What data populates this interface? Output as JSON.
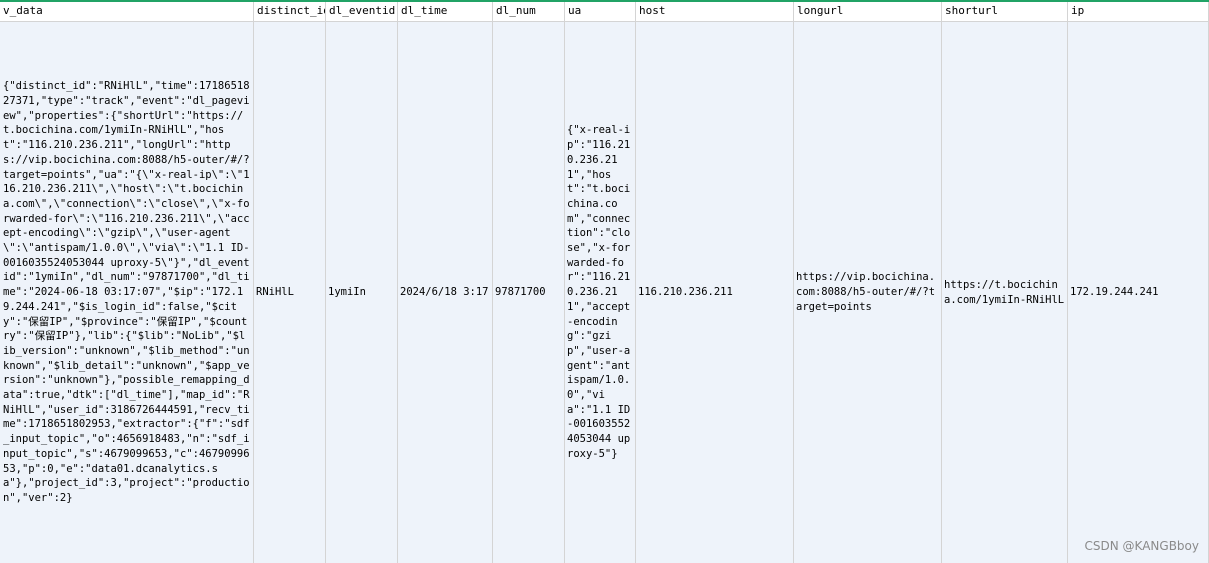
{
  "columns": [
    "v_data",
    "distinct_id",
    "dl_eventid",
    "dl_time",
    "dl_num",
    "ua",
    "host",
    "longurl",
    "shorturl",
    "ip"
  ],
  "row": {
    "v_data": "{\"distinct_id\":\"RNiHlL\",\"time\":1718651827371,\"type\":\"track\",\"event\":\"dl_pageview\",\"properties\":{\"shortUrl\":\"https://t.bocichina.com/1ymiIn-RNiHlL\",\"host\":\"116.210.236.211\",\"longUrl\":\"https://vip.bocichina.com:8088/h5-outer/#/?target=points\",\"ua\":\"{\\\"x-real-ip\\\":\\\"116.210.236.211\\\",\\\"host\\\":\\\"t.bocichina.com\\\",\\\"connection\\\":\\\"close\\\",\\\"x-forwarded-for\\\":\\\"116.210.236.211\\\",\\\"accept-encoding\\\":\\\"gzip\\\",\\\"user-agent\\\":\\\"antispam/1.0.0\\\",\\\"via\\\":\\\"1.1 ID-0016035524053044 uproxy-5\\\"}\",\"dl_eventid\":\"1ymiIn\",\"dl_num\":\"97871700\",\"dl_time\":\"2024-06-18 03:17:07\",\"$ip\":\"172.19.244.241\",\"$is_login_id\":false,\"$city\":\"保留IP\",\"$province\":\"保留IP\",\"$country\":\"保留IP\"},\"lib\":{\"$lib\":\"NoLib\",\"$lib_version\":\"unknown\",\"$lib_method\":\"unknown\",\"$lib_detail\":\"unknown\",\"$app_version\":\"unknown\"},\"possible_remapping_data\":true,\"dtk\":[\"dl_time\"],\"map_id\":\"RNiHlL\",\"user_id\":3186726444591,\"recv_time\":1718651802953,\"extractor\":{\"f\":\"sdf_input_topic\",\"o\":4656918483,\"n\":\"sdf_input_topic\",\"s\":4679099653,\"c\":4679099653,\"p\":0,\"e\":\"data01.dcanalytics.sa\"},\"project_id\":3,\"project\":\"production\",\"ver\":2}",
    "distinct_id": "RNiHlL",
    "dl_eventid": "1ymiIn",
    "dl_time": "2024/6/18 3:17",
    "dl_num": "97871700",
    "ua": "{\"x-real-ip\":\"116.210.236.211\",\"host\":\"t.bocichina.com\",\"connection\":\"close\",\"x-forwarded-for\":\"116.210.236.211\",\"accept-encoding\":\"gzip\",\"user-agent\":\"antispam/1.0.0\",\"via\":\"1.1 ID-0016035524053044 uproxy-5\"}",
    "host": "116.210.236.211",
    "longurl": "https://vip.bocichina.com:8088/h5-outer/#/?target=points",
    "shorturl": "https://t.bocichina.com/1ymiIn-RNiHlL",
    "ip": "172.19.244.241"
  },
  "watermark": "CSDN @KANGBboy",
  "colors": {
    "header_bg": "#ffffff",
    "row_bg": "#eef3fa",
    "grid_line": "#d4d4d4",
    "accent": "#21a366"
  }
}
